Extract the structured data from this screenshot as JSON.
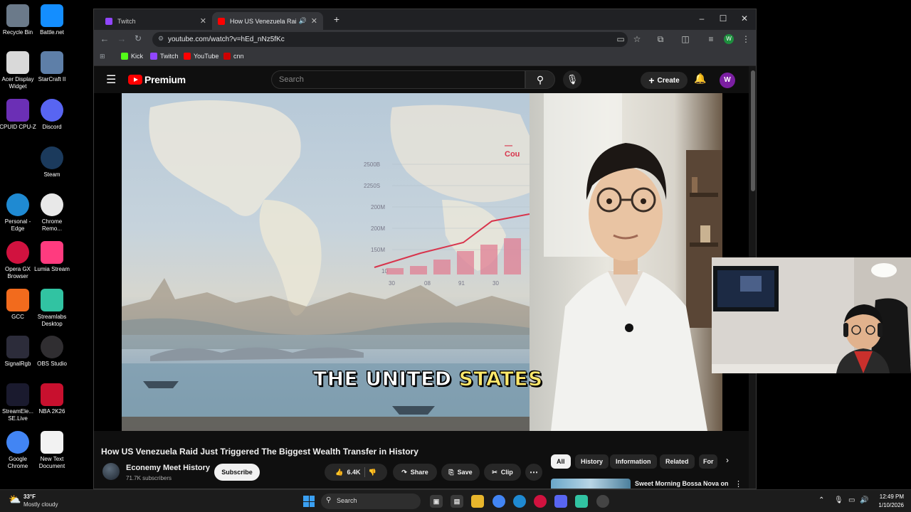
{
  "desktop": {
    "icons": [
      {
        "label": "Recycle Bin",
        "icon": "recycle-bin-icon",
        "color": "#6b7a8a"
      },
      {
        "label": "Battle.net",
        "icon": "battlenet-icon",
        "color": "#148eff"
      },
      {
        "label": "Acer Display Widget",
        "icon": "acer-widget-icon",
        "color": "#d9d9d9"
      },
      {
        "label": "StarCraft II",
        "icon": "starcraft-icon",
        "color": "#5e7fa8"
      },
      {
        "label": "CPUID CPU-Z",
        "icon": "cpuz-icon",
        "color": "#6b2fb5"
      },
      {
        "label": "Discord",
        "icon": "discord-icon",
        "color": "#5865f2"
      },
      {
        "label": "Steam",
        "icon": "steam-icon",
        "color": "#1b3a5c"
      },
      {
        "label": "Personal - Edge",
        "icon": "edge-icon",
        "color": "#1f8ad2"
      },
      {
        "label": "Chrome Remo...",
        "icon": "chrome-remote-icon",
        "color": "#e8e8e8"
      },
      {
        "label": "Opera GX Browser",
        "icon": "opera-gx-icon",
        "color": "#d1123f"
      },
      {
        "label": "Lumia Stream",
        "icon": "lumia-icon",
        "color": "#ff3b7f"
      },
      {
        "label": "GCC",
        "icon": "gcc-icon",
        "color": "#f26b1d"
      },
      {
        "label": "Streamlabs Desktop",
        "icon": "streamlabs-icon",
        "color": "#31c3a2"
      },
      {
        "label": "SignalRgb",
        "icon": "signalrgb-icon",
        "color": "#2c2c3a"
      },
      {
        "label": "OBS Studio",
        "icon": "obs-icon",
        "color": "#302e31"
      },
      {
        "label": "StreamEle... SE.Live",
        "icon": "streamelements-icon",
        "color": "#1a1a2e"
      },
      {
        "label": "NBA 2K26",
        "icon": "nba2k-icon",
        "color": "#c8102e"
      },
      {
        "label": "Google Chrome",
        "icon": "chrome-icon",
        "color": "#4285f4"
      },
      {
        "label": "New Text Document",
        "icon": "text-document-icon",
        "color": "#f2f2f2"
      }
    ]
  },
  "browser": {
    "tabs": [
      {
        "label": "Twitch",
        "color": "#9146ff",
        "active": false
      },
      {
        "label": "How US Venezuela Raid Just",
        "color": "#ff0000",
        "active": true
      }
    ],
    "new_tab": "+",
    "window_controls": {
      "minimize": "–",
      "maximize": "☐",
      "close": "✕"
    },
    "url": "youtube.com/watch?v=hEd_nNz5fKc",
    "bookmarks": [
      {
        "label": "Kick",
        "color": "#53fc18"
      },
      {
        "label": "Twitch",
        "color": "#9146ff"
      },
      {
        "label": "YouTube",
        "color": "#ff0000"
      },
      {
        "label": "cnn",
        "color": "#cc0000"
      }
    ],
    "profile_initial": "W"
  },
  "youtube": {
    "logo_text": "Premium",
    "search_placeholder": "Search",
    "create_label": "Create",
    "avatar_initial": "W",
    "video": {
      "painting_chart_legend": "— Cou",
      "painting_chart_yticks": [
        "2500B",
        "2250S",
        "200M",
        "200M",
        "150M",
        "10"
      ],
      "painting_chart_xticks": [
        "30",
        "08",
        "91",
        "30"
      ],
      "painting_chart_bars": [
        0.15,
        0.2,
        0.35,
        0.55,
        0.7,
        0.85
      ],
      "caption_white": "THE UNITED",
      "caption_yellow": "STATES"
    },
    "title": "How US Venezuela Raid Just Triggered The Biggest Wealth Transfer in History",
    "channel": {
      "name": "Econemy Meet History",
      "subscribers": "71.7K subscribers"
    },
    "subscribe_label": "Subscribe",
    "actions": {
      "likes": "6.4K",
      "share": "Share",
      "save": "Save",
      "clip": "Clip",
      "more": "⋯"
    },
    "chips": [
      "All",
      "History",
      "Information",
      "Related",
      "For"
    ],
    "recommendation": {
      "title": "Sweet Morning Bossa Nova on a Luxury Yacht ~ Relaxing Jaz"
    }
  },
  "taskbar": {
    "weather_temp": "33°F",
    "weather_condition": "Mostly cloudy",
    "search_label": "Search",
    "time": "12:49 PM",
    "date": "1/10/2026"
  }
}
